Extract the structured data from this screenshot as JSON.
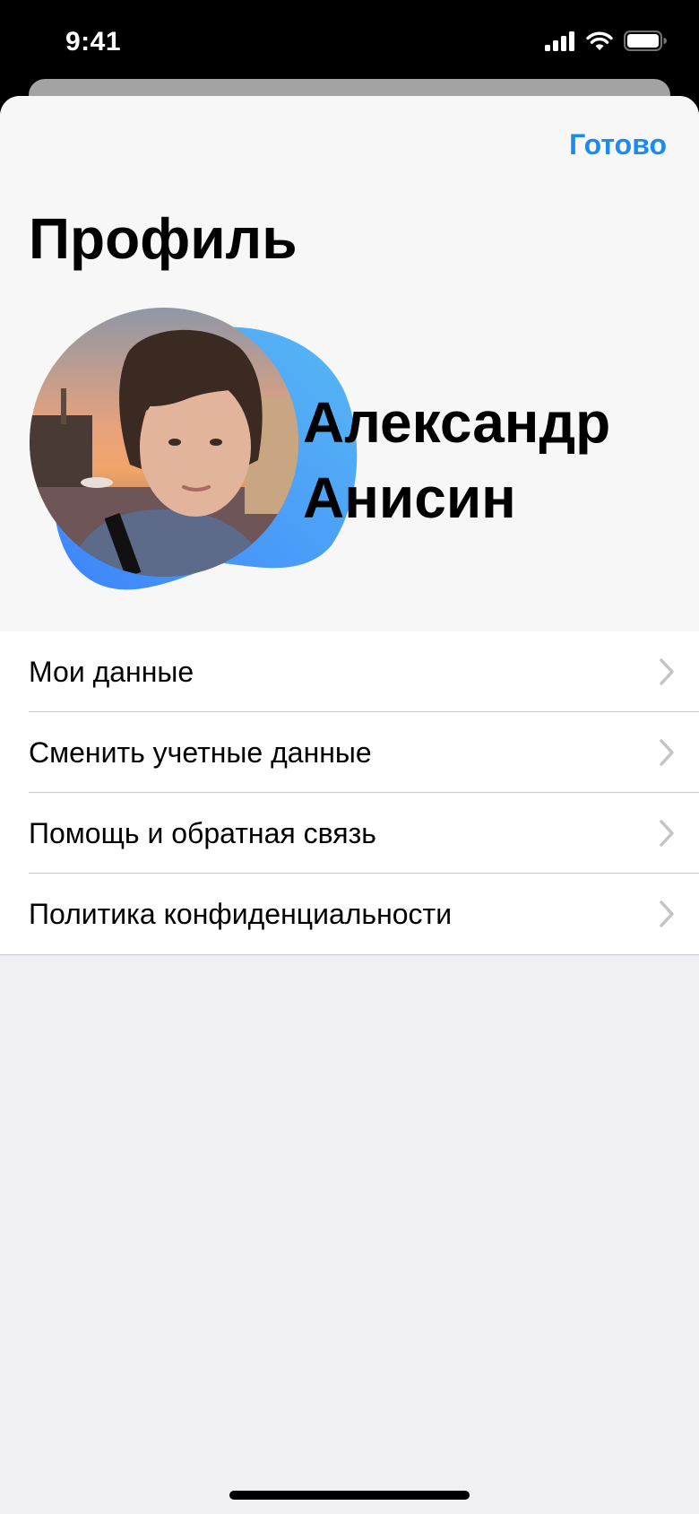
{
  "status_bar": {
    "time": "9:41",
    "icons": [
      "cellular-signal-icon",
      "wifi-icon",
      "battery-icon"
    ]
  },
  "header": {
    "done_label": "Готово",
    "title": "Профиль"
  },
  "profile": {
    "first_name": "Александр",
    "last_name": "Анисин",
    "accent_gradient": [
      "#3d8bfd",
      "#56b3f5"
    ]
  },
  "menu": {
    "items": [
      {
        "label": "Мои данные",
        "icon": "chevron-right-icon"
      },
      {
        "label": "Сменить учетные данные",
        "icon": "chevron-right-icon"
      },
      {
        "label": "Помощь и обратная связь",
        "icon": "chevron-right-icon"
      },
      {
        "label": "Политика конфиденциальности",
        "icon": "chevron-right-icon"
      }
    ]
  },
  "colors": {
    "accent": "#1a8cf0",
    "background": "#efeff4",
    "header_background": "#f7f7f7"
  }
}
